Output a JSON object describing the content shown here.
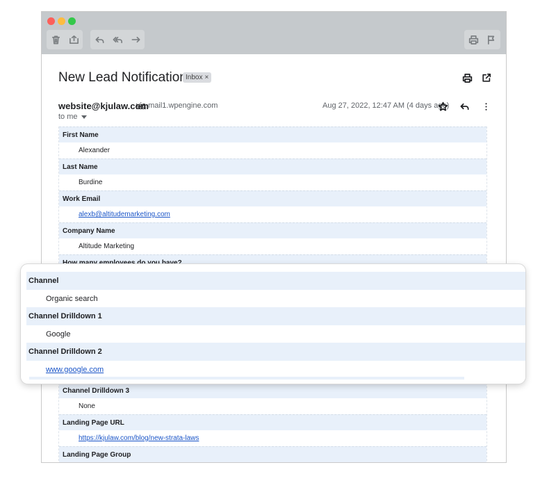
{
  "email": {
    "subject": "New Lead Notification",
    "label_chip": "Inbox",
    "label_chip_close": "×",
    "sender": "website@kjulaw.com",
    "via_word": "via",
    "via_domain": "mail1.wpengine.com",
    "date": "Aug 27, 2022, 12:47 AM (4 days ago)",
    "recipient": "to me"
  },
  "fields": [
    {
      "label": "First Name",
      "value": "Alexander"
    },
    {
      "label": "Last Name",
      "value": "Burdine"
    },
    {
      "label": "Work Email",
      "value": "alexb@altitudemarketing.com"
    },
    {
      "label": "Company Name",
      "value": "Altitude Marketing"
    },
    {
      "label": "How many employees do you have?"
    }
  ],
  "fields_after": [
    {
      "label": "Channel Drilldown 3",
      "value": "None"
    },
    {
      "label": "Landing Page URL",
      "value": "https://kjulaw.com/blog/new-strata-laws"
    },
    {
      "label": "Landing Page Group"
    }
  ],
  "highlight": [
    {
      "label": "Channel",
      "value": "Organic search"
    },
    {
      "label": "Channel Drilldown 1",
      "value": "Google"
    },
    {
      "label": "Channel Drilldown 2",
      "value": "www.google.com"
    }
  ],
  "icons": {
    "toolbar": [
      "trash-icon",
      "move-to-icon",
      "reply-icon",
      "reply-all-icon",
      "forward-icon",
      "print-icon",
      "flag-icon"
    ],
    "header": [
      "print-icon",
      "open-in-new-icon",
      "star-icon",
      "reply-icon",
      "more-vert-icon"
    ]
  },
  "colors": {
    "titlebar": "#c5c9cc",
    "row_header_bg": "#e8f0fa",
    "link": "#1a55c8",
    "close": "#fc605b",
    "minimize": "#fdbc40",
    "zoom": "#34c84a"
  }
}
